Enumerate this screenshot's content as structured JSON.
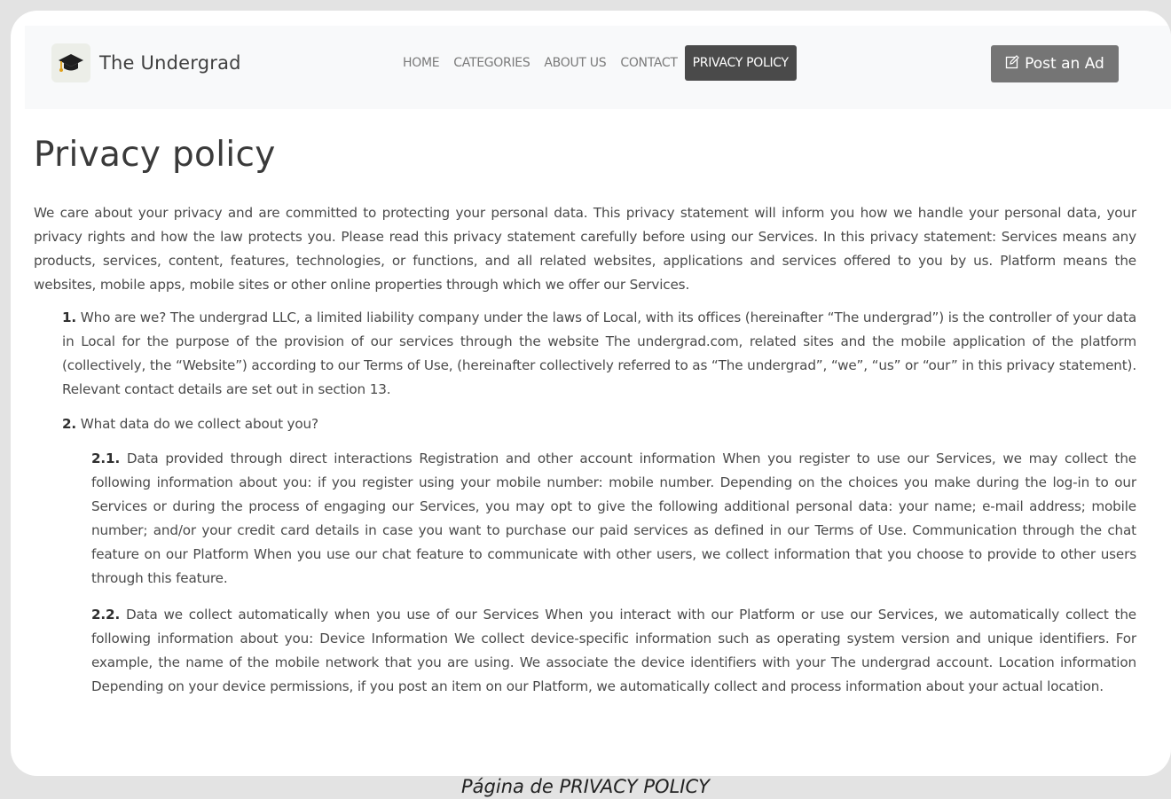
{
  "brand": {
    "name": "The Undergrad",
    "logo_icon": "graduation-cap-icon"
  },
  "nav": {
    "items": [
      {
        "label": "HOME"
      },
      {
        "label": "CATEGORIES"
      },
      {
        "label": "ABOUT US"
      },
      {
        "label": "CONTACT"
      },
      {
        "label": "PRIVACY POLICY",
        "active": true
      }
    ]
  },
  "post_ad": {
    "label": "Post an Ad",
    "icon": "edit-icon"
  },
  "page": {
    "title": "Privacy policy",
    "intro": "We care about your privacy and are committed to protecting your personal data. This privacy statement will inform you how we handle your personal data, your privacy rights and how the law protects you. Please read this privacy statement carefully before using our Services. In this privacy statement: Services means any products, services, content, features, technologies, or functions, and all related websites, applications and services offered to you by us. Platform means the websites, mobile apps, mobile sites or other online properties through which we offer our Services.",
    "sections": [
      {
        "number": "1.",
        "text": " Who are we? The undergrad LLC, a limited liability company under the laws of Local, with its offices (hereinafter “The undergrad”) is the controller of your data in Local for the purpose of the provision of our services through the website The undergrad.com, related sites and the mobile application of the platform (collectively, the “Website”) according to our Terms of Use, (hereinafter collectively referred to as “The undergrad”, “we”, “us” or “our” in this privacy statement). Relevant contact details are set out in section 13."
      },
      {
        "number": "2.",
        "text": " What data do we collect about you?"
      },
      {
        "number": "2.1.",
        "text": " Data provided through direct interactions Registration and other account information When you register to use our Services, we may collect the following information about you: if you register using your mobile number: mobile number. Depending on the choices you make during the log-in to our Services or during the process of engaging our Services, you may opt to give the following additional personal data: your name; e-mail address; mobile number; and/or your credit card details in case you want to purchase our paid services as defined in our Terms of Use. Communication through the chat feature on our Platform When you use our chat feature to communicate with other users, we collect information that you choose to provide to other users through this feature."
      },
      {
        "number": "2.2.",
        "text": " Data we collect automatically when you use of our Services When you interact with our Platform or use our Services, we automatically collect the following information about you: Device Information We collect device-specific information such as operating system version and unique identifiers. For example, the name of the mobile network that you are using. We associate the device identifiers with your The undergrad account. Location information Depending on your device permissions, if you post an item on our Platform, we automatically collect and process information about your actual location."
      }
    ]
  },
  "caption": "Página de PRIVACY POLICY",
  "colors": {
    "background": "#e3e3e3",
    "navbar": "#f8f9fa",
    "active_nav": "#4a4a4a",
    "post_button": "#757575"
  }
}
